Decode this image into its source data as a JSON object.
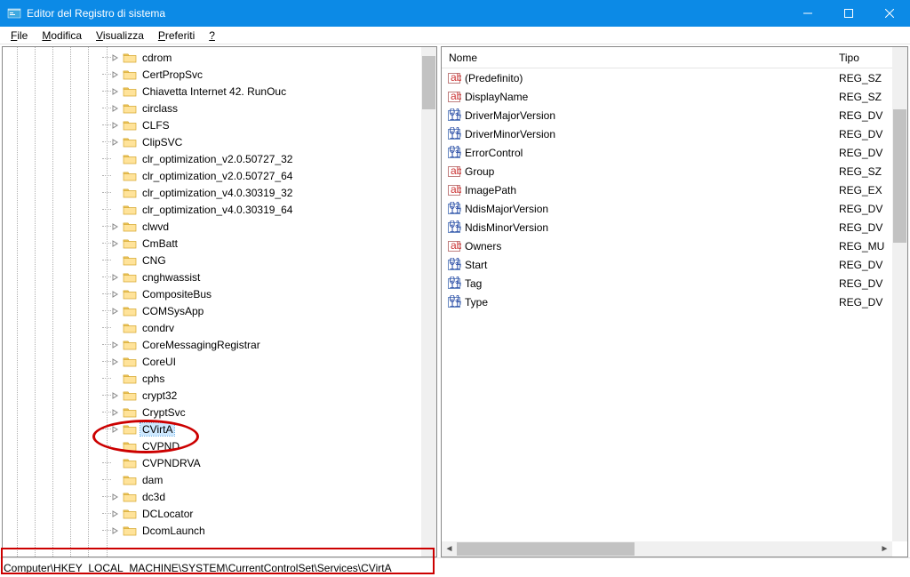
{
  "app": {
    "title": "Editor del Registro di sistema"
  },
  "menu": {
    "file": "File",
    "edit": "Modifica",
    "view": "Visualizza",
    "favorites": "Preferiti",
    "help": "?"
  },
  "tree": {
    "nodes": [
      {
        "label": "cdrom",
        "expander": true
      },
      {
        "label": "CertPropSvc",
        "expander": true
      },
      {
        "label": "Chiavetta Internet 42. RunOuc",
        "expander": true
      },
      {
        "label": "circlass",
        "expander": true
      },
      {
        "label": "CLFS",
        "expander": true
      },
      {
        "label": "ClipSVC",
        "expander": true
      },
      {
        "label": "clr_optimization_v2.0.50727_32",
        "expander": false
      },
      {
        "label": "clr_optimization_v2.0.50727_64",
        "expander": false
      },
      {
        "label": "clr_optimization_v4.0.30319_32",
        "expander": false
      },
      {
        "label": "clr_optimization_v4.0.30319_64",
        "expander": false
      },
      {
        "label": "clwvd",
        "expander": true
      },
      {
        "label": "CmBatt",
        "expander": true
      },
      {
        "label": "CNG",
        "expander": false
      },
      {
        "label": "cnghwassist",
        "expander": true
      },
      {
        "label": "CompositeBus",
        "expander": true
      },
      {
        "label": "COMSysApp",
        "expander": true
      },
      {
        "label": "condrv",
        "expander": false
      },
      {
        "label": "CoreMessagingRegistrar",
        "expander": true
      },
      {
        "label": "CoreUI",
        "expander": true
      },
      {
        "label": "cphs",
        "expander": false
      },
      {
        "label": "crypt32",
        "expander": true
      },
      {
        "label": "CryptSvc",
        "expander": true
      },
      {
        "label": "CVirtA",
        "expander": true,
        "selected": true
      },
      {
        "label": "CVPND",
        "expander": false
      },
      {
        "label": "CVPNDRVA",
        "expander": false
      },
      {
        "label": "dam",
        "expander": false
      },
      {
        "label": "dc3d",
        "expander": true
      },
      {
        "label": "DCLocator",
        "expander": true
      },
      {
        "label": "DcomLaunch",
        "expander": true
      }
    ]
  },
  "list": {
    "headers": {
      "name": "Nome",
      "type": "Tipo"
    },
    "rows": [
      {
        "name": "(Predefinito)",
        "type": "REG_SZ",
        "kind": "sz"
      },
      {
        "name": "DisplayName",
        "type": "REG_SZ",
        "kind": "sz"
      },
      {
        "name": "DriverMajorVersion",
        "type": "REG_DV",
        "kind": "dw"
      },
      {
        "name": "DriverMinorVersion",
        "type": "REG_DV",
        "kind": "dw"
      },
      {
        "name": "ErrorControl",
        "type": "REG_DV",
        "kind": "dw"
      },
      {
        "name": "Group",
        "type": "REG_SZ",
        "kind": "sz"
      },
      {
        "name": "ImagePath",
        "type": "REG_EX",
        "kind": "sz"
      },
      {
        "name": "NdisMajorVersion",
        "type": "REG_DV",
        "kind": "dw"
      },
      {
        "name": "NdisMinorVersion",
        "type": "REG_DV",
        "kind": "dw"
      },
      {
        "name": "Owners",
        "type": "REG_MU",
        "kind": "sz"
      },
      {
        "name": "Start",
        "type": "REG_DV",
        "kind": "dw"
      },
      {
        "name": "Tag",
        "type": "REG_DV",
        "kind": "dw"
      },
      {
        "name": "Type",
        "type": "REG_DV",
        "kind": "dw"
      }
    ]
  },
  "path": "Computer\\HKEY_LOCAL_MACHINE\\SYSTEM\\CurrentControlSet\\Services\\CVirtA"
}
